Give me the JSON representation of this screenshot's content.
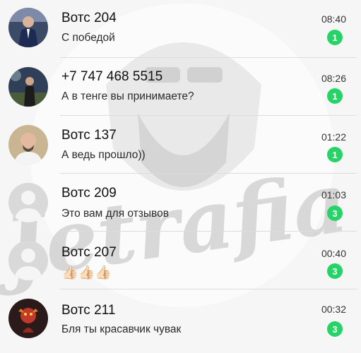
{
  "colors": {
    "unread_badge": "#25d366",
    "divider": "#dcdcdc"
  },
  "watermark": {
    "text": "Jetrafia",
    "icon": "bearded-man-logo"
  },
  "chats": [
    {
      "name": "Вотс 204",
      "preview": "С победой",
      "time": "08:40",
      "unread": "1",
      "avatar_icon": "man-in-suit-avatar"
    },
    {
      "name": "+7 747 468 5515",
      "preview": "А в тенге вы принимаете?",
      "time": "08:26",
      "unread": "1",
      "avatar_icon": "man-outdoors-avatar"
    },
    {
      "name": "Вотс 137",
      "preview": "А ведь прошло))",
      "time": "01:22",
      "unread": "1",
      "avatar_icon": "bald-man-avatar"
    },
    {
      "name": "Вотс 209",
      "preview": "Это вам для отзывов",
      "time": "01:03",
      "unread": "3",
      "avatar_icon": "default-user-avatar"
    },
    {
      "name": "Вотс 207",
      "preview": "👍🏻👍🏻👍🏻",
      "time": "00:40",
      "unread": "3",
      "avatar_icon": "default-user-avatar"
    },
    {
      "name": "Вотс 211",
      "preview": "Бля ты красавчик чувак",
      "time": "00:32",
      "unread": "3",
      "avatar_icon": "red-character-avatar"
    }
  ]
}
